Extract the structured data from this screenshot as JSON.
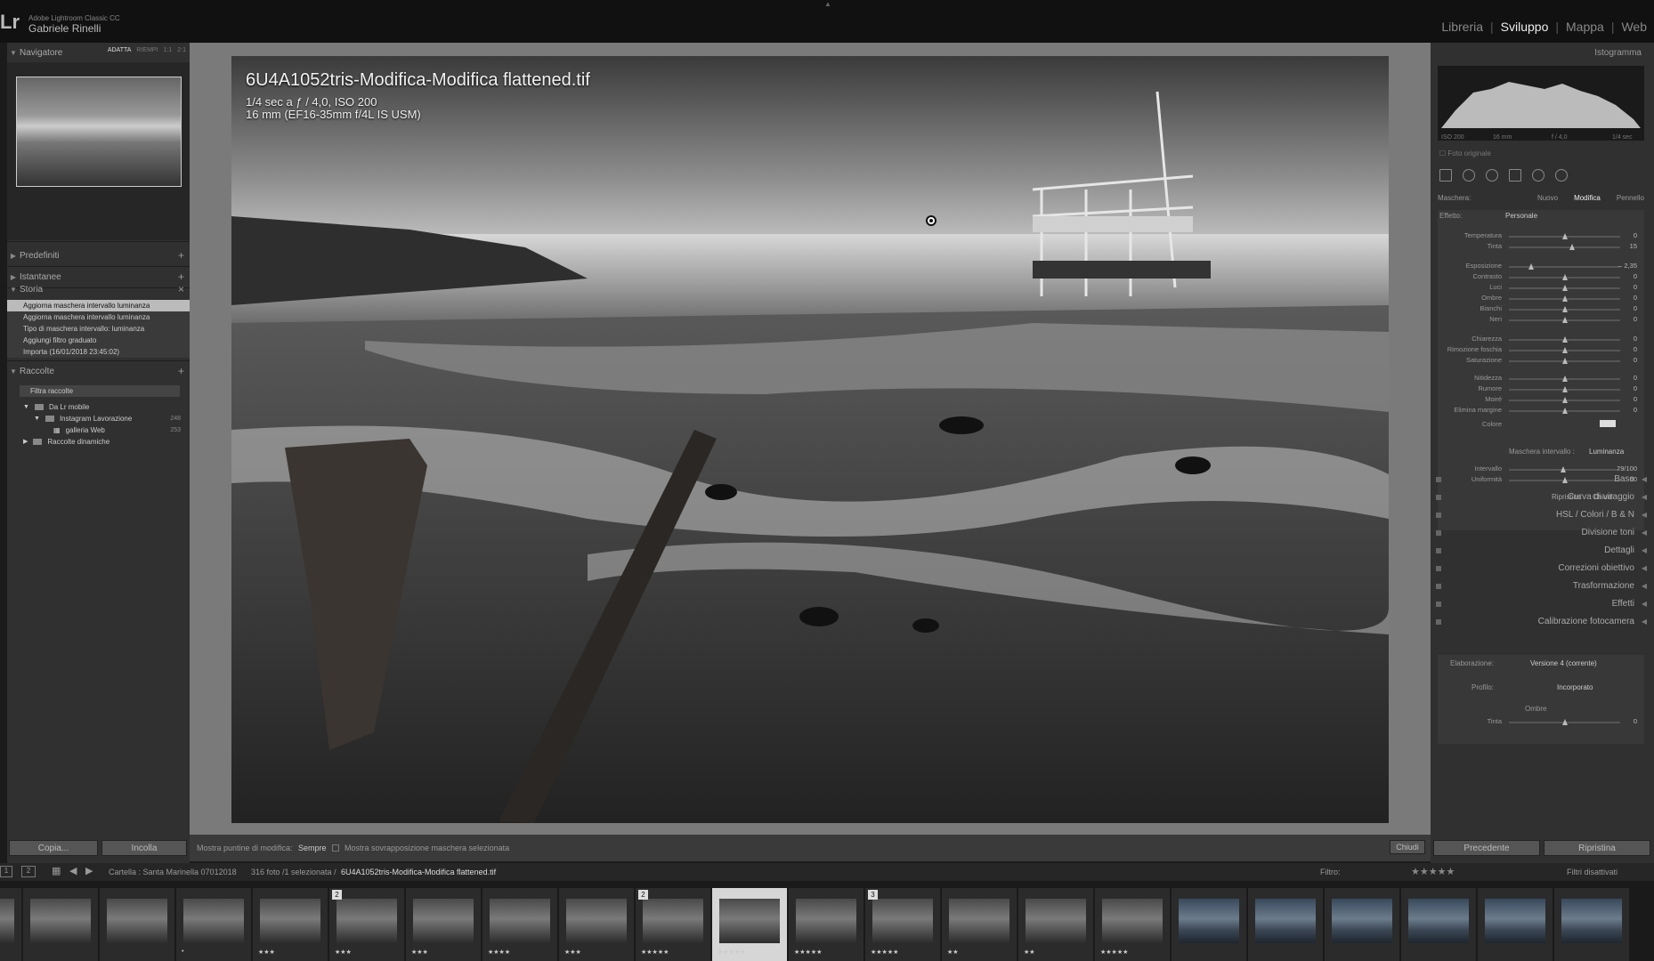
{
  "app": {
    "name": "Adobe Lightroom Classic CC",
    "user": "Gabriele Rinelli",
    "logo": "Lr"
  },
  "modules": [
    "Libreria",
    "Sviluppo",
    "Mappa",
    "Web"
  ],
  "active_module": "Sviluppo",
  "navigator": {
    "title": "Navigatore",
    "options": [
      "ADATTA",
      "RIEMPI",
      "1:1",
      "2:1"
    ],
    "selected": "ADATTA"
  },
  "left_sections": {
    "presets": "Predefiniti",
    "snapshots": "Istantanee",
    "history": "Storia",
    "collections": "Raccolte"
  },
  "history_items": [
    "Aggiorna maschera intervallo luminanza",
    "Aggiorna maschera intervallo luminanza",
    "Tipo di maschera intervallo: luminanza",
    "Aggiungi filtro graduato",
    "Importa (16/01/2018 23:45:02)"
  ],
  "collections": {
    "filter": "Filtra raccolte",
    "items": [
      {
        "label": "Da Lr mobile",
        "count": ""
      },
      {
        "label": "Instagram Lavorazione",
        "count": "248"
      },
      {
        "label": "galleria Web",
        "count": "253"
      },
      {
        "label": "Raccolte dinamiche",
        "count": ""
      }
    ]
  },
  "left_buttons": {
    "copy": "Copia...",
    "paste": "Incolla"
  },
  "overlay": {
    "filename": "6U4A1052tris-Modifica-Modifica flattened.tif",
    "exposure": "1/4 sec a ƒ / 4,0, ISO 200",
    "lens": "16 mm (EF16-35mm f/4L IS USM)"
  },
  "toolbar": {
    "pin_label": "Mostra puntine di modifica:",
    "pin_value": "Sempre",
    "overlay_label": "Mostra sovrapposizione maschera selezionata",
    "close": "Chiudi"
  },
  "histogram": {
    "title": "Istogramma",
    "iso": "ISO 200",
    "focal": "16 mm",
    "aperture": "f / 4,0",
    "shutter": "1/4 sec",
    "original": "Foto originale"
  },
  "mask": {
    "label": "Maschera:",
    "new": "Nuovo",
    "edit": "Modifica",
    "brush": "Pennello",
    "effect_label": "Effetto:",
    "effect_value": "Personale"
  },
  "sliders": [
    {
      "label": "Temperatura",
      "value": "0",
      "pos": 0.5
    },
    {
      "label": "Tinta",
      "value": "15",
      "pos": 0.57
    },
    {
      "label": "Esposizione",
      "value": "– 2,35",
      "pos": 0.2
    },
    {
      "label": "Contrasto",
      "value": "0",
      "pos": 0.5
    },
    {
      "label": "Luci",
      "value": "0",
      "pos": 0.5
    },
    {
      "label": "Ombre",
      "value": "0",
      "pos": 0.5
    },
    {
      "label": "Bianchi",
      "value": "0",
      "pos": 0.5
    },
    {
      "label": "Neri",
      "value": "0",
      "pos": 0.5
    },
    {
      "label": "Chiarezza",
      "value": "0",
      "pos": 0.5
    },
    {
      "label": "Rimozione foschia",
      "value": "0",
      "pos": 0.5
    },
    {
      "label": "Saturazione",
      "value": "0",
      "pos": 0.5
    },
    {
      "label": "Nitidezza",
      "value": "0",
      "pos": 0.5
    },
    {
      "label": "Rumore",
      "value": "0",
      "pos": 0.5
    },
    {
      "label": "Moiré",
      "value": "0",
      "pos": 0.5
    },
    {
      "label": "Elimina margine",
      "value": "0",
      "pos": 0.5
    }
  ],
  "color_label": "Colore",
  "range_mask": {
    "label": "Maschera intervallo :",
    "value": "Luminanza",
    "interval": "Intervallo",
    "interval_value": "79/100",
    "uniformity": "Uniformità",
    "uniformity_value": "50",
    "reset": "Ripristina",
    "close": "Chiudi"
  },
  "right_sections": [
    "Base",
    "Curva di viraggio",
    "HSL / Colori / B & N",
    "Divisione toni",
    "Dettagli",
    "Correzioni obiettivo",
    "Trasformazione",
    "Effetti",
    "Calibrazione fotocamera"
  ],
  "calibration": {
    "process_label": "Elaborazione:",
    "process_value": "Versione 4 (corrente)",
    "profile_label": "Profilo:",
    "profile_value": "Incorporato",
    "shadows": "Ombre",
    "tint": "Tinta",
    "tint_value": "0"
  },
  "right_buttons": {
    "prev": "Precedente",
    "reset": "Ripristina"
  },
  "filmbar": {
    "folder": "Cartella : Santa Marinella 07012018",
    "count": "316 foto /1 selezionata /",
    "current": "6U4A1052tris-Modifica-Modifica flattened.tif",
    "filter_label": "Filtro:",
    "filter_state": "Filtri disattivati"
  },
  "filmstrip": [
    {
      "badge": "",
      "stars": "•",
      "blue": false
    },
    {
      "badge": "",
      "stars": "",
      "blue": false
    },
    {
      "badge": "",
      "stars": "",
      "blue": false
    },
    {
      "badge": "",
      "stars": "•",
      "blue": false
    },
    {
      "badge": "",
      "stars": "★★★",
      "blue": false
    },
    {
      "badge": "2",
      "stars": "★★★",
      "blue": false
    },
    {
      "badge": "",
      "stars": "★★★",
      "blue": false
    },
    {
      "badge": "",
      "stars": "★★★★",
      "blue": false
    },
    {
      "badge": "",
      "stars": "★★★",
      "blue": false
    },
    {
      "badge": "2",
      "stars": "★★★★★",
      "blue": false
    },
    {
      "badge": "",
      "stars": "★★★★★",
      "blue": false
    },
    {
      "badge": "",
      "stars": "★★★★★",
      "blue": false
    },
    {
      "badge": "3",
      "stars": "★★★★★",
      "blue": false
    },
    {
      "badge": "",
      "stars": "★★",
      "blue": false
    },
    {
      "badge": "",
      "stars": "★★",
      "blue": false
    },
    {
      "badge": "",
      "stars": "★★★★★",
      "blue": false
    },
    {
      "badge": "",
      "stars": "",
      "blue": true
    },
    {
      "badge": "",
      "stars": "",
      "blue": true
    },
    {
      "badge": "",
      "stars": "",
      "blue": true
    },
    {
      "badge": "",
      "stars": "",
      "blue": true
    },
    {
      "badge": "",
      "stars": "",
      "blue": true
    },
    {
      "badge": "",
      "stars": "",
      "blue": true
    }
  ],
  "selected_thumb": 10
}
